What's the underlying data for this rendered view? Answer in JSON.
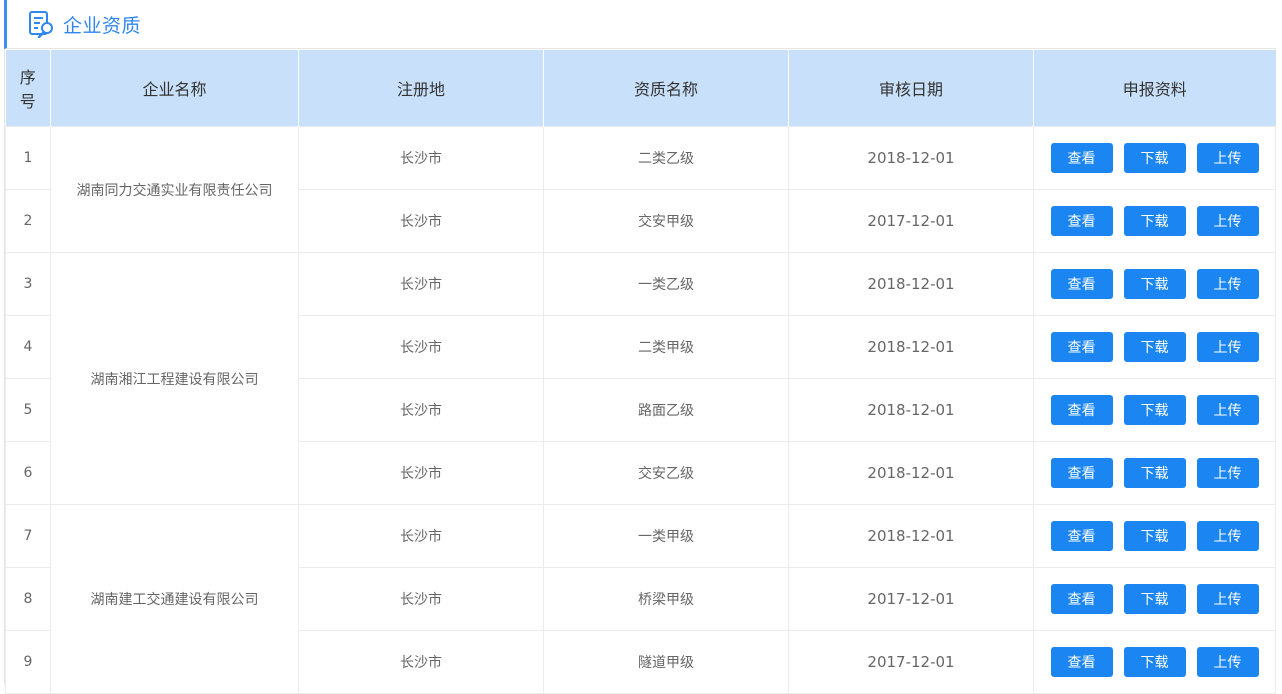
{
  "page": {
    "title": "企业资质",
    "accent": "#2f87f0",
    "button_color": "#1b86f2",
    "header_bg": "#c8e0f9"
  },
  "table": {
    "headers": {
      "seq_line1": "序",
      "seq_line2": "号",
      "company": "企业名称",
      "location": "注册地",
      "qualification": "资质名称",
      "date": "审核日期",
      "materials": "申报资料"
    },
    "companies": [
      "湖南同力交通实业有限责任公司",
      "湖南湘江工程建设有限公司",
      "湖南建工交通建设有限公司"
    ],
    "rows": [
      {
        "seq": "1",
        "location": "长沙市",
        "qualification": "二类乙级",
        "date": "2018-12-01"
      },
      {
        "seq": "2",
        "location": "长沙市",
        "qualification": "交安甲级",
        "date": "2017-12-01"
      },
      {
        "seq": "3",
        "location": "长沙市",
        "qualification": "一类乙级",
        "date": "2018-12-01"
      },
      {
        "seq": "4",
        "location": "长沙市",
        "qualification": "二类甲级",
        "date": "2018-12-01"
      },
      {
        "seq": "5",
        "location": "长沙市",
        "qualification": "路面乙级",
        "date": "2018-12-01"
      },
      {
        "seq": "6",
        "location": "长沙市",
        "qualification": "交安乙级",
        "date": "2018-12-01"
      },
      {
        "seq": "7",
        "location": "长沙市",
        "qualification": "一类甲级",
        "date": "2018-12-01"
      },
      {
        "seq": "8",
        "location": "长沙市",
        "qualification": "桥梁甲级",
        "date": "2017-12-01"
      },
      {
        "seq": "9",
        "location": "长沙市",
        "qualification": "隧道甲级",
        "date": "2017-12-01"
      }
    ],
    "actions": {
      "view": "查看",
      "download": "下载",
      "upload": "上传"
    }
  }
}
